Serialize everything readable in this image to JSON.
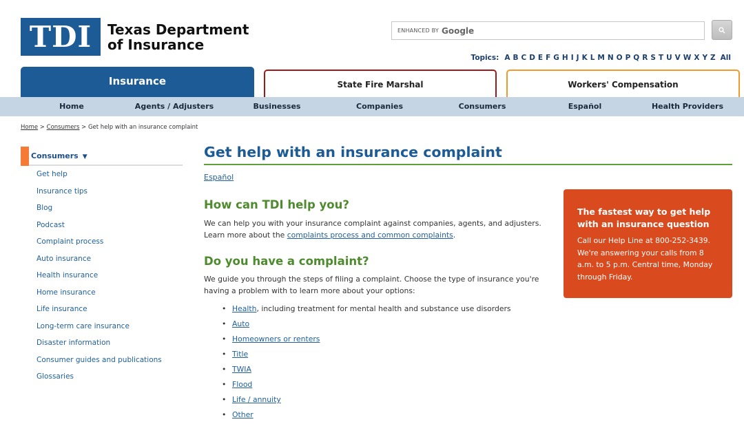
{
  "header": {
    "logo_letters": "TDI",
    "logo_line1": "Texas Department",
    "logo_line2": "of Insurance",
    "search_enhanced": "ENHANCED BY",
    "search_brand": "Google",
    "topics_label": "Topics:",
    "topics_letters": [
      "A",
      "B",
      "C",
      "D",
      "E",
      "F",
      "G",
      "H",
      "I",
      "J",
      "K",
      "L",
      "M",
      "N",
      "O",
      "P",
      "Q",
      "R",
      "S",
      "T",
      "U",
      "V",
      "W",
      "X",
      "Y",
      "Z"
    ],
    "topics_all": "All"
  },
  "tabs": {
    "insurance": "Insurance",
    "fire_marshal": "State Fire Marshal",
    "workers_comp": "Workers' Compensation"
  },
  "nav": [
    "Home",
    "Agents / Adjusters",
    "Businesses",
    "Companies",
    "Consumers",
    "Español",
    "Health Providers"
  ],
  "breadcrumb": {
    "home": "Home",
    "sep1": " > ",
    "consumers": "Consumers",
    "sep2": " > ",
    "current": "Get help with an insurance complaint"
  },
  "sidebar": {
    "title": "Consumers",
    "items": [
      "Get help",
      "Insurance tips",
      "Blog",
      "Podcast",
      "Complaint process",
      "Auto insurance",
      "Health insurance",
      "Home insurance",
      "Life insurance",
      "Long-term care insurance",
      "Disaster information",
      "Consumer guides and publications",
      "Glossaries"
    ]
  },
  "main": {
    "title": "Get help with an insurance complaint",
    "espanol": "Español",
    "section1_title": "How can TDI help you?",
    "section1_text": "We can help you with your insurance complaint against companies, agents, and adjusters. Learn more about the ",
    "section1_link": "complaints process and common complaints",
    "section1_end": ".",
    "section2_title": "Do you have a complaint?",
    "section2_text": "We guide you through the steps of filing a complaint. Choose the type of insurance you're having a problem with to learn more about your options:",
    "options": [
      {
        "link": "Health",
        "rest": ", including treatment for mental health and substance use disorders"
      },
      {
        "link": "Auto",
        "rest": ""
      },
      {
        "link": "Homeowners or renters",
        "rest": ""
      },
      {
        "link": "Title",
        "rest": ""
      },
      {
        "link": "TWIA",
        "rest": ""
      },
      {
        "link": "Flood",
        "rest": ""
      },
      {
        "link": "Life / annuity",
        "rest": ""
      },
      {
        "link": "Other",
        "rest": ""
      }
    ]
  },
  "callout": {
    "heading": "The fastest way to get help with an insurance question",
    "body": "Call our Help Line at 800-252-3439. We're answering your calls from 8 a.m. to 5 p.m. Central time, Monday through Friday."
  },
  "colors": {
    "brand_blue": "#1d5b96",
    "nav_bar": "#c5d5e4",
    "section_green": "#4e8a2e",
    "callout_orange": "#d94a1e",
    "sidebar_accent": "#f47a35",
    "fire_marshal_red": "#9b1b1b",
    "workers_comp_orange": "#ef9a2b"
  }
}
